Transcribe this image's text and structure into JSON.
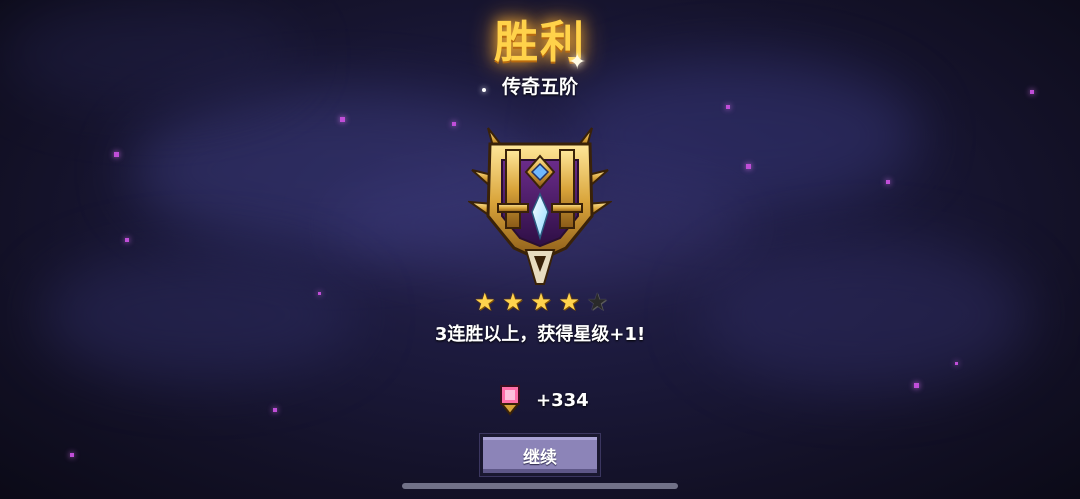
{
  "title": "胜利",
  "rank": {
    "name": "传奇五阶"
  },
  "stars": {
    "filled": 4,
    "total": 5
  },
  "streak_message": "3连胜以上，获得星级+1!",
  "reward": {
    "icon": "rank-point-icon",
    "amount": "+334"
  },
  "continue_button": {
    "label": "继续"
  },
  "colors": {
    "title": "#ffd24a",
    "button": "#8c84b8",
    "particle": "#c04ed8",
    "star": "#ffd34d"
  }
}
